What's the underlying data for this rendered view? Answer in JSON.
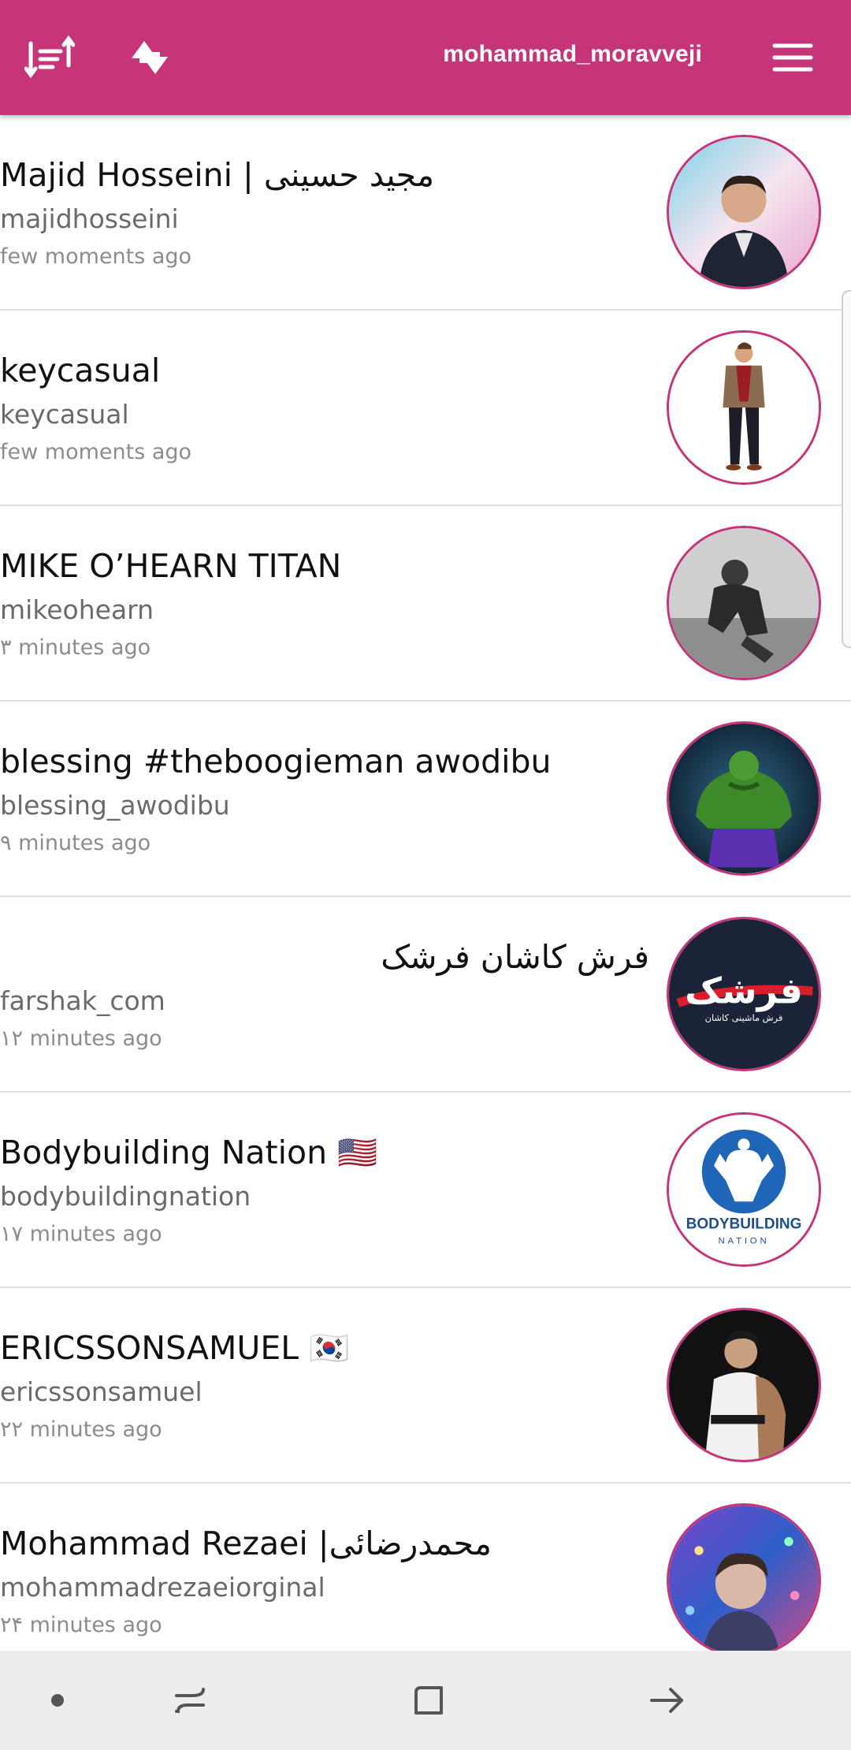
{
  "header": {
    "username": "mohammad_moravveji",
    "background_color": "#c6357a",
    "icons": [
      "sort-icon",
      "sync-icon",
      "hamburger-menu-icon"
    ]
  },
  "accounts": [
    {
      "name": "Majid Hosseini | مجید حسینی",
      "handle": "majidhosseini",
      "time": "few moments ago",
      "avatar": "portrait-man-suit"
    },
    {
      "name": "keycasual",
      "handle": "keycasual",
      "time": "few moments ago",
      "avatar": "illustration-man-blazer"
    },
    {
      "name": "MIKE O’HEARN TITAN",
      "handle": "mikeohearn",
      "time": "۳ minutes ago",
      "avatar": "bodybuilder-grayscale"
    },
    {
      "name": "blessing #theboogieman awodibu",
      "handle": "blessing_awodibu",
      "time": "۹ minutes ago",
      "avatar": "green-hulk"
    },
    {
      "name": "فرش کاشان فرشک",
      "handle": "farshak_com",
      "time": "۱۲ minutes ago",
      "avatar": "farshak-logo",
      "rtl": true,
      "logo_text": "فرشک",
      "logo_subtext": "فرش ماشینی کاشان"
    },
    {
      "name": "Bodybuilding Nation 🇺🇸",
      "handle": "bodybuildingnation",
      "time": "۱۷ minutes ago",
      "avatar": "bodybuilding-nation-logo",
      "logo_text": "BODYBUILDING",
      "logo_subtext": "NATION"
    },
    {
      "name": "ERICSSONSAMUEL 🇰🇷",
      "handle": "ericssonsamuel",
      "time": "۲۲ minutes ago",
      "avatar": "martial-artist"
    },
    {
      "name": "Mohammad Rezaei |محمدرضائی",
      "handle": "mohammadrezaeiorginal",
      "time": "۲۴ minutes ago",
      "avatar": "young-man-lights"
    }
  ],
  "navbar": {
    "icons": [
      "dot-icon",
      "recent-apps-icon",
      "home-square-icon",
      "back-arrow-icon"
    ]
  }
}
